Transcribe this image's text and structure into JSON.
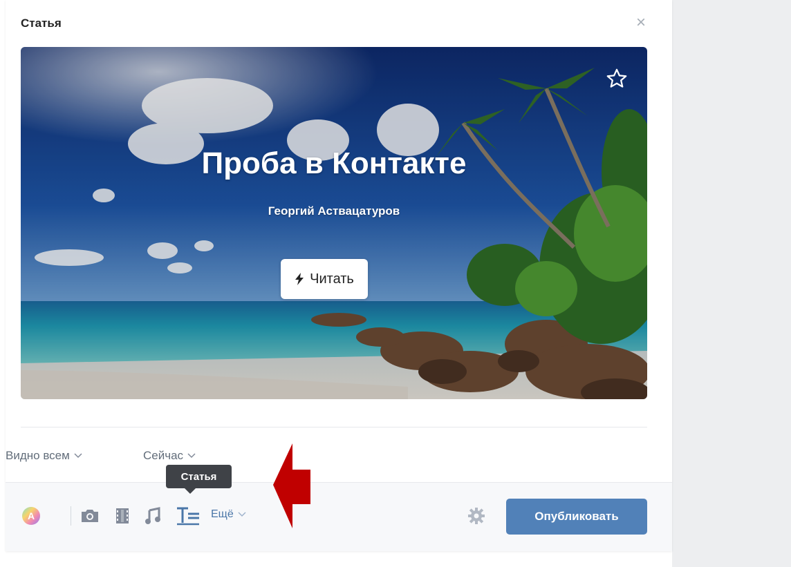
{
  "window": {
    "title": "Статья",
    "close_icon": "close-icon"
  },
  "cover": {
    "title": "Проба в Контакте",
    "author": "Георгий Аствацатуров",
    "read_label": "Читать",
    "read_icon": "lightning-icon",
    "favorite_icon": "star-icon"
  },
  "meta": {
    "visibility": "Видно всем",
    "time": "Сейчас"
  },
  "tooltip": {
    "text": "Статья"
  },
  "toolbar": {
    "more_label": "Ещё",
    "publish_label": "Опубликовать",
    "icons": [
      "avatar-icon",
      "camera-icon",
      "video-icon",
      "music-icon",
      "article-icon",
      "gear-icon"
    ]
  },
  "colors": {
    "accent": "#5181b8",
    "link": "#4a76a8",
    "arrow": "#c00000",
    "sidebar_bg": "#edeef0"
  }
}
